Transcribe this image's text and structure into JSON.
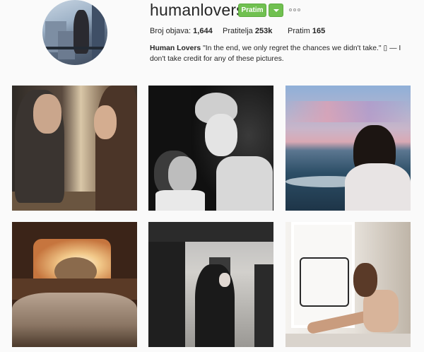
{
  "profile": {
    "username": "humanlovers",
    "follow_label": "Pratim",
    "stats": {
      "posts_label": "Broj objava:",
      "posts_value": "1,644",
      "followers_label": "Pratitelja",
      "followers_value": "253k",
      "following_label": "Pratim",
      "following_value": "165"
    },
    "bio_name": "Human Lovers",
    "bio_text": " \"In the end, we only regret the chances we didn't take.\" ▯ — I don't take credit for any of these pictures."
  },
  "icons": {
    "dropdown": "chevron-down-icon",
    "more": "more-options-icon"
  },
  "colors": {
    "follow_button": "#70c050",
    "background": "#fafafa"
  }
}
